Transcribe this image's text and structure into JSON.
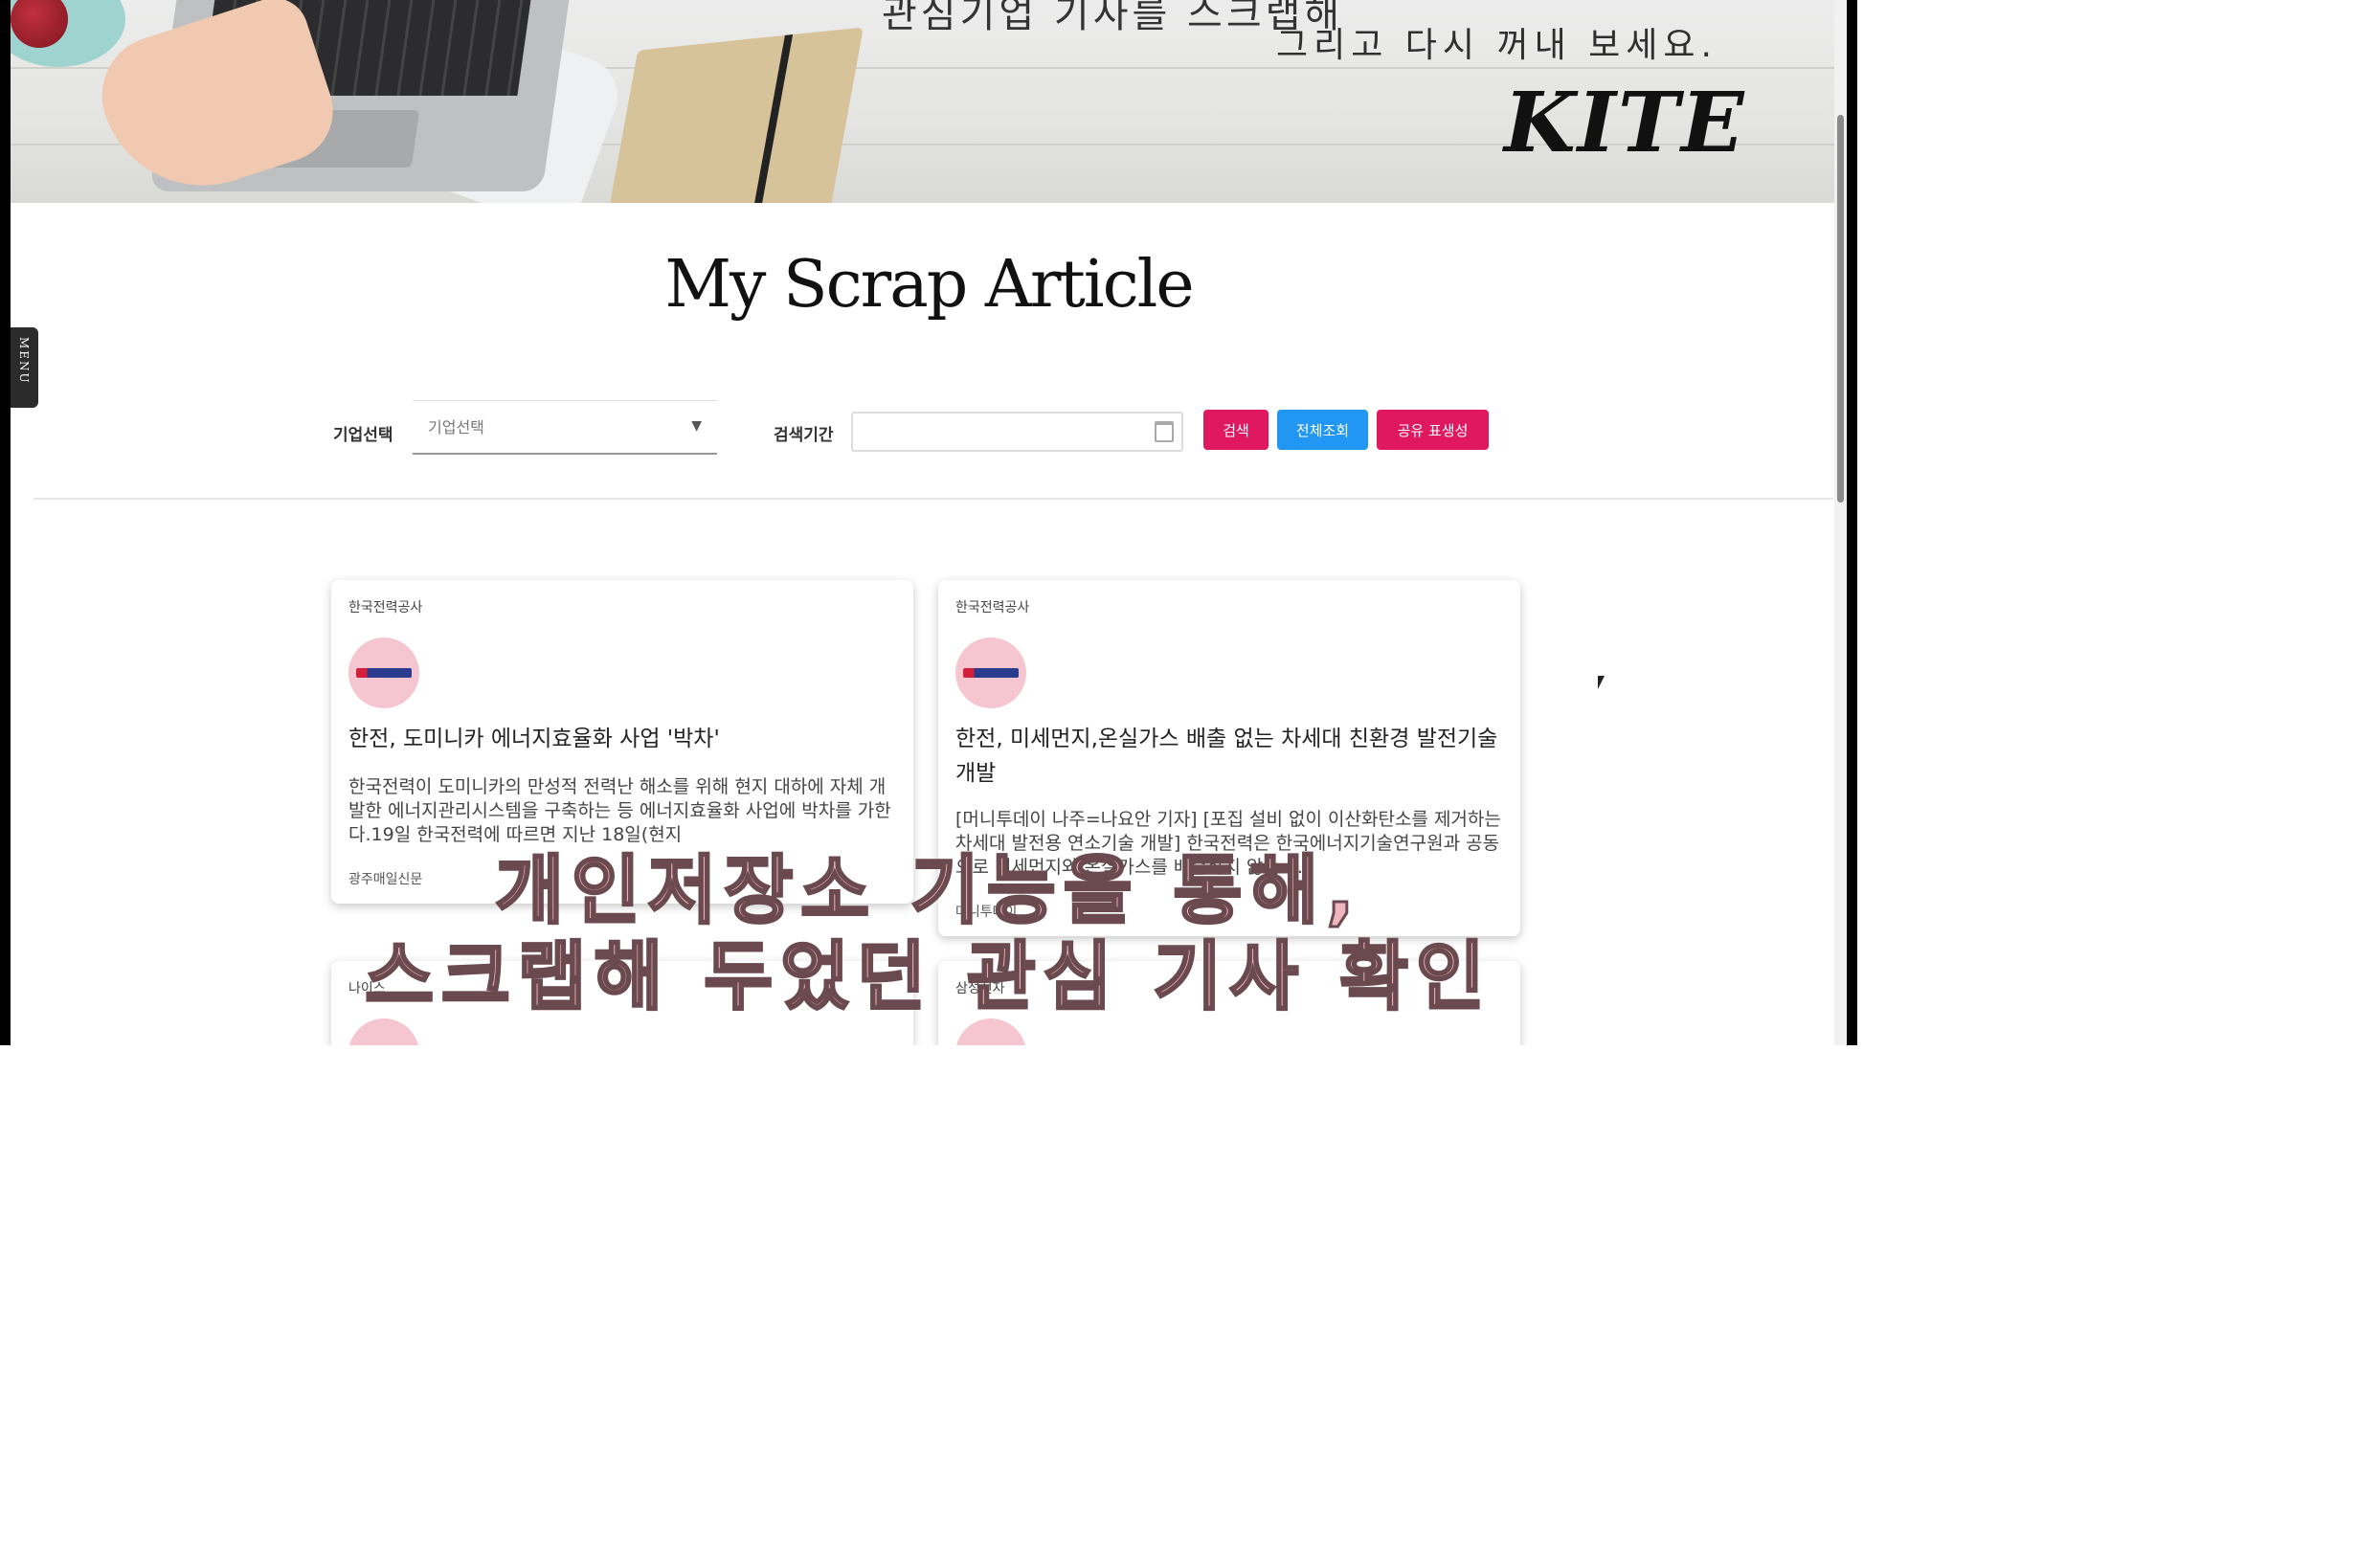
{
  "banner": {
    "line1": "그리고 다시 꺼내 보세요.",
    "line_partial": "관심기업 기사를 스크랩해",
    "brand": "KITE"
  },
  "menu_tab": "MENU",
  "page_title": "My Scrap Article",
  "filters": {
    "company_label": "기업선택",
    "company_placeholder": "기업선택",
    "period_label": "검색기간",
    "date_value": ""
  },
  "buttons": {
    "search": "검색",
    "view_all": "전체조회",
    "share": "공유 표생성"
  },
  "colors": {
    "search_button": "#e0185f",
    "view_all_button": "#2196f3",
    "share_button": "#e0185f"
  },
  "articles": [
    {
      "company": "한국전력공사",
      "title": "한전, 도미니카 에너지효율화 사업 '박차'",
      "summary": "한국전력이 도미니카의 만성적 전력난 해소를 위해 현지 대하에 자체 개발한 에너지관리시스템을 구축하는 등 에너지효율화 사업에 박차를 가한다.19일 한국전력에 따르면 지난 18일(현지",
      "source": "광주매일신문"
    },
    {
      "company": "한국전력공사",
      "title": "한전, 미세먼지,온실가스 배출 없는 차세대 친환경 발전기술 개발",
      "summary": "[머니투데이 나주=나요안 기자] [포집 설비 없이 이산화탄소를 제거하는 차세대 발전용 연소기술 개발] 한국전력은 한국에너지기술연구원과 공동으로 미세먼지와 온실가스를 배출하지 않는 ...",
      "source": "머니투데이"
    },
    {
      "company": "나이스"
    },
    {
      "company": "삼성전자"
    }
  ],
  "overlay_caption": {
    "line1": "개인저장소 기능을 통해,",
    "line2": "스크랩해 두었던 관심 기사 확인"
  }
}
